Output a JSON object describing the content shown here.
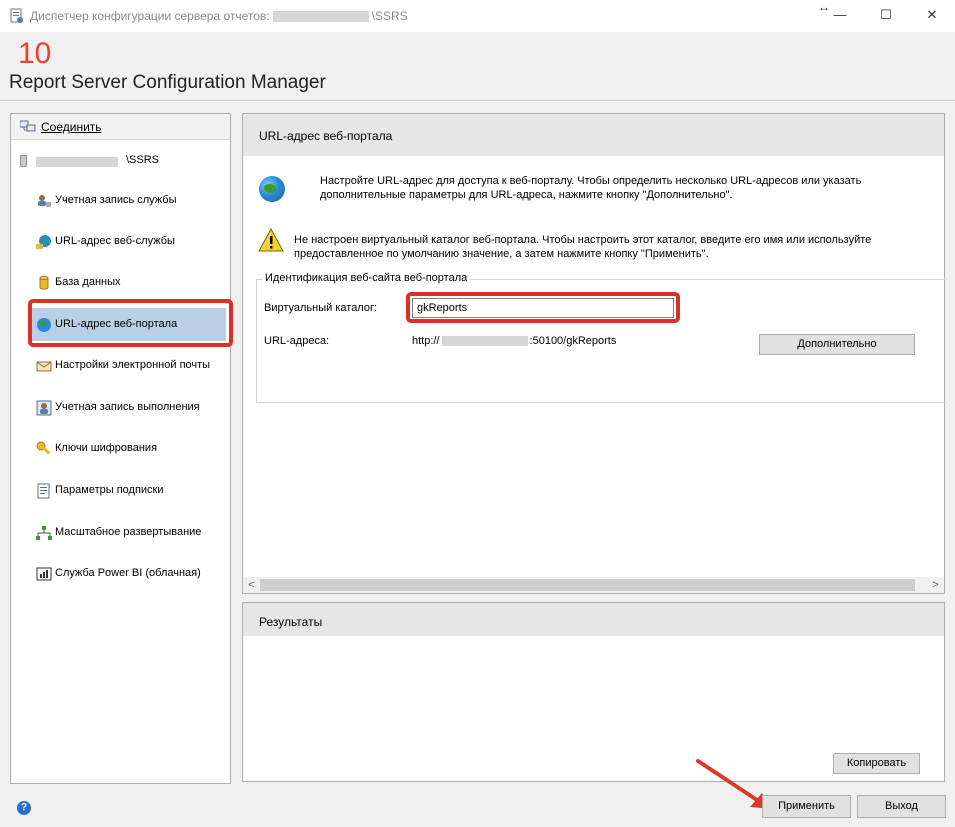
{
  "window": {
    "title_prefix": "Диспетчер конфигурации сервера отчетов:",
    "title_suffix": "\\SSRS",
    "minimize": "—",
    "maximize": "☐",
    "close": "✕",
    "resize_glyph": "↔"
  },
  "header": {
    "step_number": "10",
    "app_title": "Report Server Configuration Manager"
  },
  "sidebar": {
    "connect_label": "Соединить",
    "server_suffix": "\\SSRS",
    "items": [
      {
        "label": "Учетная запись службы",
        "icon": "service-account-icon"
      },
      {
        "label": "URL-адрес веб-службы",
        "icon": "web-service-url-icon"
      },
      {
        "label": "База данных",
        "icon": "database-icon"
      },
      {
        "label": "URL-адрес веб-портала",
        "icon": "web-portal-url-icon",
        "selected": true
      },
      {
        "label": "Настройки электронной почты",
        "icon": "email-icon"
      },
      {
        "label": "Учетная запись выполнения",
        "icon": "execution-account-icon"
      },
      {
        "label": "Ключи шифрования",
        "icon": "encryption-keys-icon"
      },
      {
        "label": "Параметры подписки",
        "icon": "subscription-icon"
      },
      {
        "label": "Масштабное развертывание",
        "icon": "scale-out-icon"
      },
      {
        "label": "Служба Power BI (облачная)",
        "icon": "power-bi-icon"
      }
    ]
  },
  "main": {
    "title": "URL-адрес веб-портала",
    "intro": "Настройте URL-адрес для доступа к веб-порталу. Чтобы определить несколько URL-адресов или указать дополнительные параметры для URL-адреса, нажмите кнопку \"Дополнительно\".",
    "warning": "Не настроен виртуальный каталог веб-портала. Чтобы настроить этот каталог, введите его имя или используйте предоставленное по умолчанию значение, а затем нажмите кнопку \"Применить\".",
    "group_legend": "Идентификация веб-сайта веб-портала",
    "vdir_label": "Виртуальный каталог:",
    "vdir_value": "gkReports",
    "urls_label": "URL-адреса:",
    "url_prefix": "http://",
    "url_suffix": ":50100/gkReports",
    "advanced_button": "Дополнительно",
    "scroll_left": "<",
    "scroll_right": ">"
  },
  "results": {
    "title": "Результаты",
    "copy_button": "Копировать"
  },
  "footer": {
    "help": "?",
    "apply_button": "Применить",
    "exit_button": "Выход"
  },
  "colors": {
    "highlight_frame": "#d9302a",
    "selected_item": "#b8cfe6",
    "step_number": "#e8412c"
  }
}
